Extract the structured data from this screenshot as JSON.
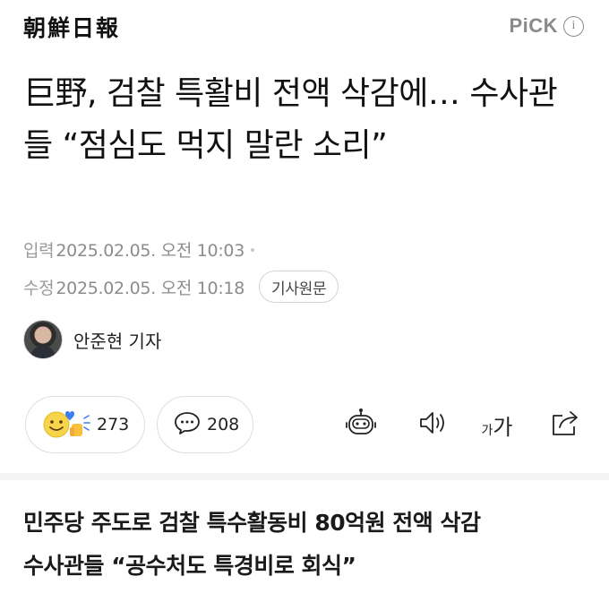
{
  "header": {
    "press_name": "朝鮮日報",
    "pick_label": "PiCK",
    "info_glyph": "i"
  },
  "article": {
    "headline": "巨野, 검찰 특활비 전액 삭감에… 수사관들 “점심도 먹지 말란 소리”",
    "input_label": "입력",
    "input_datetime": "2025.02.05. 오전 10:03",
    "modified_label": "수정",
    "modified_datetime": "2025.02.05. 오전 10:18",
    "original_button": "기사원문",
    "author": "안준현 기자",
    "subheadline_line1": "민주당 주도로 검찰 특수활동비 80억원 전액 삭감",
    "subheadline_line2": "수사관들 “공수처도 특경비로 회식”"
  },
  "reactions": {
    "like_count": "273",
    "comment_count": "208",
    "font_small": "가",
    "font_large": "가"
  },
  "icons": {
    "like": "emoji-reaction-icon",
    "comment": "speech-bubble-icon",
    "summary": "robot-icon",
    "tts": "speaker-icon",
    "font": "font-size-icon",
    "share": "share-icon"
  },
  "colors": {
    "meta_text": "#9a9a9a",
    "pick": "#8a8a8a",
    "emoji_yellow": "#f7d44a",
    "heart_blue": "#3b7df2",
    "divider": "#f4f4f4"
  }
}
